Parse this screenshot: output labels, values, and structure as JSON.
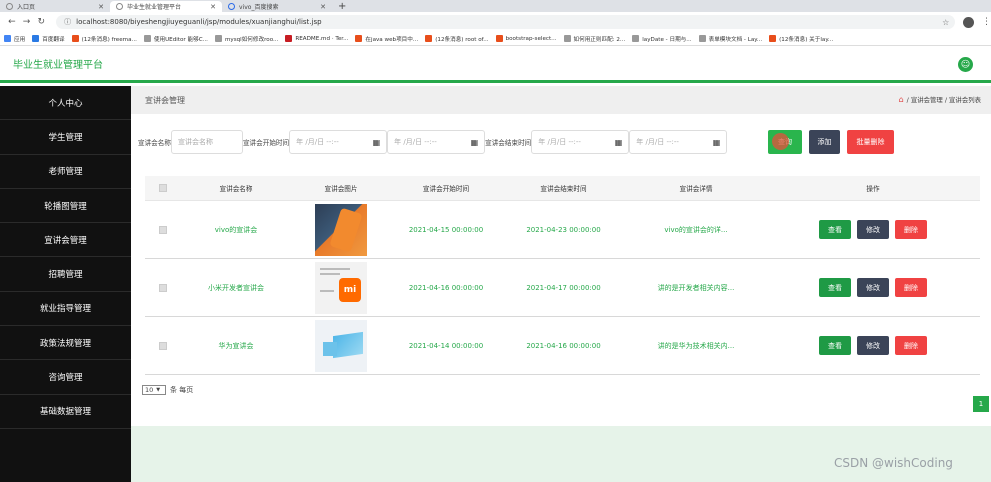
{
  "browser": {
    "tabs": [
      {
        "label": "入口页",
        "active": false
      },
      {
        "label": "毕业生就业管理平台",
        "active": true
      },
      {
        "label": "vivo_百度搜索",
        "active": false
      }
    ],
    "new_tab": "+",
    "url": "localhost:8080/biyeshengjiuyeguanli/jsp/modules/xuanjianghui/list.jsp",
    "bookmarks": [
      {
        "label": "应用",
        "color": "#4285f4"
      },
      {
        "label": "百度翻译",
        "color": "#2a7ae4"
      },
      {
        "label": "(12条消息) freema...",
        "color": "#e84e1b"
      },
      {
        "label": "使用UEditor 能够C...",
        "color": "#999999"
      },
      {
        "label": "mysql如何修改roo...",
        "color": "#999999"
      },
      {
        "label": "README.md · Ter...",
        "color": "#c71d23"
      },
      {
        "label": "在java web项目中...",
        "color": "#e84e1b"
      },
      {
        "label": "(12条消息) root of...",
        "color": "#e84e1b"
      },
      {
        "label": "bootstrap-select...",
        "color": "#e84e1b"
      },
      {
        "label": "如何用正则匹配: 2...",
        "color": "#999999"
      },
      {
        "label": "layDate - 日期与...",
        "color": "#999999"
      },
      {
        "label": "表单模块文档 - Lay...",
        "color": "#999999"
      },
      {
        "label": "(12条消息) 关于lay...",
        "color": "#e84e1b"
      }
    ]
  },
  "header": {
    "title": "毕业生就业管理平台"
  },
  "sidebar": {
    "items": [
      {
        "label": "个人中心"
      },
      {
        "label": "学生管理"
      },
      {
        "label": "老师管理"
      },
      {
        "label": "轮播图管理"
      },
      {
        "label": "宣讲会管理"
      },
      {
        "label": "招聘管理"
      },
      {
        "label": "就业指导管理"
      },
      {
        "label": "政策法规管理"
      },
      {
        "label": "咨询管理"
      },
      {
        "label": "基础数据管理"
      }
    ]
  },
  "main": {
    "page_title": "宣讲会管理",
    "breadcrumb": {
      "part1": "宣讲会管理",
      "sep": "/",
      "part2": "宣讲会列表"
    },
    "search": {
      "name_label": "宣讲会名称",
      "name_placeholder": "宣讲会名称",
      "start_label": "宣讲会开始时间",
      "end_label": "宣讲会结束时间",
      "date_placeholder": "年 /月/日  --:--",
      "search_button": "查询",
      "add_button": "添加",
      "batch_delete_button": "批量删除"
    },
    "table": {
      "headers": [
        "宣讲会名称",
        "宣讲会图片",
        "宣讲会开始时间",
        "宣讲会结束时间",
        "宣讲会详情",
        "操作"
      ],
      "rows": [
        {
          "name": "vivo的宣讲会",
          "start": "2021-04-15 00:00:00",
          "end": "2021-04-23 00:00:00",
          "detail": "vivo的宣讲会的详...",
          "image": "vivo-phone"
        },
        {
          "name": "小米开发者宣讲会",
          "start": "2021-04-16 00:00:00",
          "end": "2021-04-17 00:00:00",
          "detail": "讲的是开发者相关内容...",
          "image": "mi-logo"
        },
        {
          "name": "华为宣讲会",
          "start": "2021-04-14 00:00:00",
          "end": "2021-04-16 00:00:00",
          "detail": "讲的是华为技术相关内...",
          "image": "huawei-tv"
        }
      ],
      "ops": {
        "view": "查看",
        "edit": "修改",
        "delete": "删除"
      }
    },
    "pagination": {
      "page_size": "10",
      "page_size_suffix": "条 每页",
      "current_page": "1"
    }
  },
  "watermark": "CSDN @wishCoding"
}
